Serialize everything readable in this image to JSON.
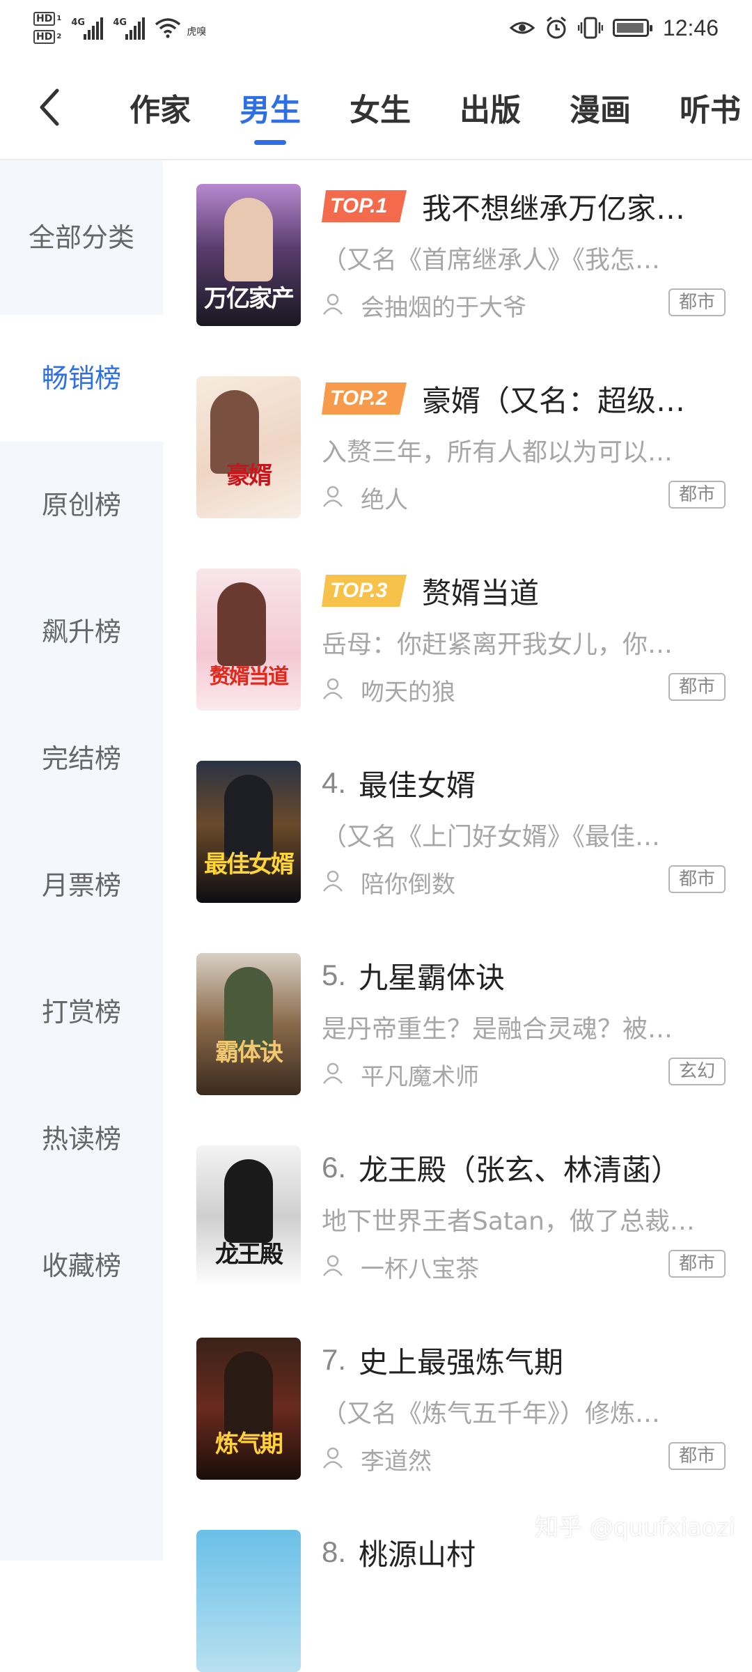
{
  "status_bar": {
    "hd1": "HD",
    "hd1_sub": "1",
    "hd2": "HD",
    "hd2_sub": "2",
    "sig1": "4G",
    "sig2": "4G",
    "wifi_label": "虎嗅",
    "time": "12:46"
  },
  "nav": {
    "tabs": [
      "作家",
      "男生",
      "女生",
      "出版",
      "漫画",
      "听书"
    ],
    "active_tab": "男生"
  },
  "sidebar": {
    "items": [
      "全部分类",
      "畅销榜",
      "原创榜",
      "飙升榜",
      "完结榜",
      "月票榜",
      "打赏榜",
      "热读榜",
      "收藏榜"
    ],
    "active_item": "畅销榜"
  },
  "books": [
    {
      "rank": "1",
      "badge": "TOP.1",
      "title": "我不想继承万亿家…",
      "desc": "（又名《首席继承人》《我怎…",
      "author": "会抽烟的于大爷",
      "tag": "都市",
      "cover_text": "万亿家产"
    },
    {
      "rank": "2",
      "badge": "TOP.2",
      "title": "豪婿（又名：超级…",
      "desc": "入赘三年，所有人都以为可以…",
      "author": "绝人",
      "tag": "都市",
      "cover_text": "豪婿"
    },
    {
      "rank": "3",
      "badge": "TOP.3",
      "title": "赘婿当道",
      "desc": "岳母：你赶紧离开我女儿，你…",
      "author": "吻天的狼",
      "tag": "都市",
      "cover_text": "赘婿当道"
    },
    {
      "rank": "4.",
      "title": "最佳女婿",
      "desc": "（又名《上门好女婿》《最佳…",
      "author": "陪你倒数",
      "tag": "都市",
      "cover_text": "最佳女婿"
    },
    {
      "rank": "5.",
      "title": "九星霸体诀",
      "desc": "是丹帝重生？是融合灵魂？被…",
      "author": "平凡魔术师",
      "tag": "玄幻",
      "cover_text": "霸体诀"
    },
    {
      "rank": "6.",
      "title": "龙王殿（张玄、林清菡）",
      "desc": "地下世界王者Satan，做了总裁…",
      "author": "一杯八宝茶",
      "tag": "都市",
      "cover_text": "龙王殿"
    },
    {
      "rank": "7.",
      "title": "史上最强炼气期",
      "desc": "（又名《炼气五千年》）修炼…",
      "author": "李道然",
      "tag": "都市",
      "cover_text": "炼气期"
    },
    {
      "rank": "8.",
      "title": "桃源山村",
      "desc": "",
      "author": "",
      "tag": "",
      "cover_text": ""
    }
  ],
  "watermark": "知乎 @quufxiaozi",
  "colors": {
    "accent": "#2f6fe6",
    "badge_1": "#f36b4c",
    "badge_2": "#f79a4a",
    "badge_3": "#f6c24a"
  }
}
